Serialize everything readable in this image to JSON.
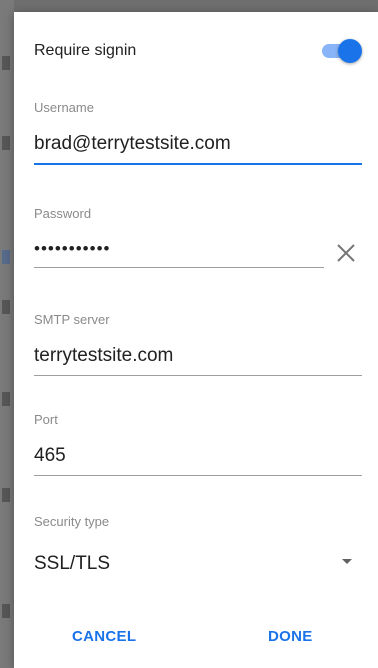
{
  "dialog": {
    "require_signin": {
      "label": "Require signin",
      "enabled": true
    },
    "username": {
      "label": "Username",
      "value": "brad@terrytestsite.com"
    },
    "password": {
      "label": "Password",
      "value": "•••••••••••"
    },
    "smtp_server": {
      "label": "SMTP server",
      "value": "terrytestsite.com"
    },
    "port": {
      "label": "Port",
      "value": "465"
    },
    "security_type": {
      "label": "Security type",
      "value": "SSL/TLS"
    },
    "buttons": {
      "cancel": "CANCEL",
      "done": "DONE"
    }
  },
  "colors": {
    "accent": "#1a73e8",
    "switch_track": "#8ab4f8",
    "label_gray": "#8a8a8a",
    "text": "#212121",
    "scrim": "#6f6f6f"
  },
  "icons": {
    "clear": "close-x-icon",
    "dropdown": "caret-down-icon"
  }
}
